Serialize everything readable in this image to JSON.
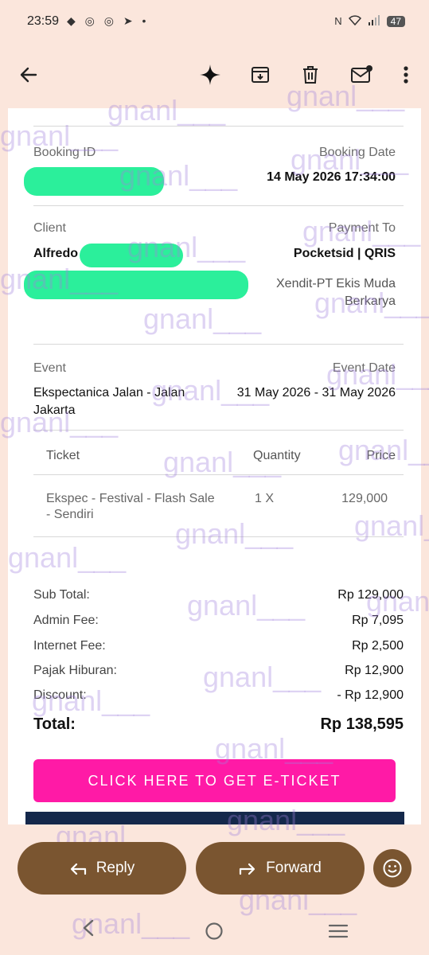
{
  "status_bar": {
    "time": "23:59",
    "battery": "47"
  },
  "booking": {
    "booking_id_label": "Booking ID",
    "booking_date_label": "Booking Date",
    "booking_date": "14 May 2026 17:34:00",
    "client_label": "Client",
    "client_name": "Alfredo",
    "payment_to_label": "Payment To",
    "payment_to": "Pocketsid | QRIS",
    "payment_provider_line1": "Xendit-PT Ekis Muda",
    "payment_provider_line2": "Berkarya",
    "event_label": "Event",
    "event_date_label": "Event Date",
    "event_name_line1": "Ekspectanica Jalan - Jalan",
    "event_name_line2": "Jakarta",
    "event_date": "31 May 2026 - 31 May 2026"
  },
  "tickets": {
    "headers": {
      "ticket": "Ticket",
      "quantity": "Quantity",
      "price": "Price"
    },
    "rows": [
      {
        "name_line1": "Ekspec - Festival - Flash Sale",
        "name_line2": "- Sendiri",
        "quantity": "1 X",
        "price": "129,000"
      }
    ]
  },
  "summary": {
    "sub_total_label": "Sub Total:",
    "sub_total": "Rp 129,000",
    "admin_fee_label": "Admin Fee:",
    "admin_fee": "Rp 7,095",
    "internet_fee_label": "Internet Fee:",
    "internet_fee": "Rp 2,500",
    "pajak_label": "Pajak Hiburan:",
    "pajak": "Rp 12,900",
    "discount_label": "Discount:",
    "discount": "- Rp 12,900",
    "total_label": "Total:",
    "total": "Rp 138,595"
  },
  "cta": {
    "label": "CLICK HERE TO GET E-TICKET"
  },
  "bottom_actions": {
    "reply": "Reply",
    "forward": "Forward"
  },
  "watermark": {
    "text": "gnanl___"
  },
  "colors": {
    "cta": "#ff1aa6",
    "pill": "#7a5530",
    "redaction": "#2bef9b",
    "background": "#fbe6dc"
  }
}
